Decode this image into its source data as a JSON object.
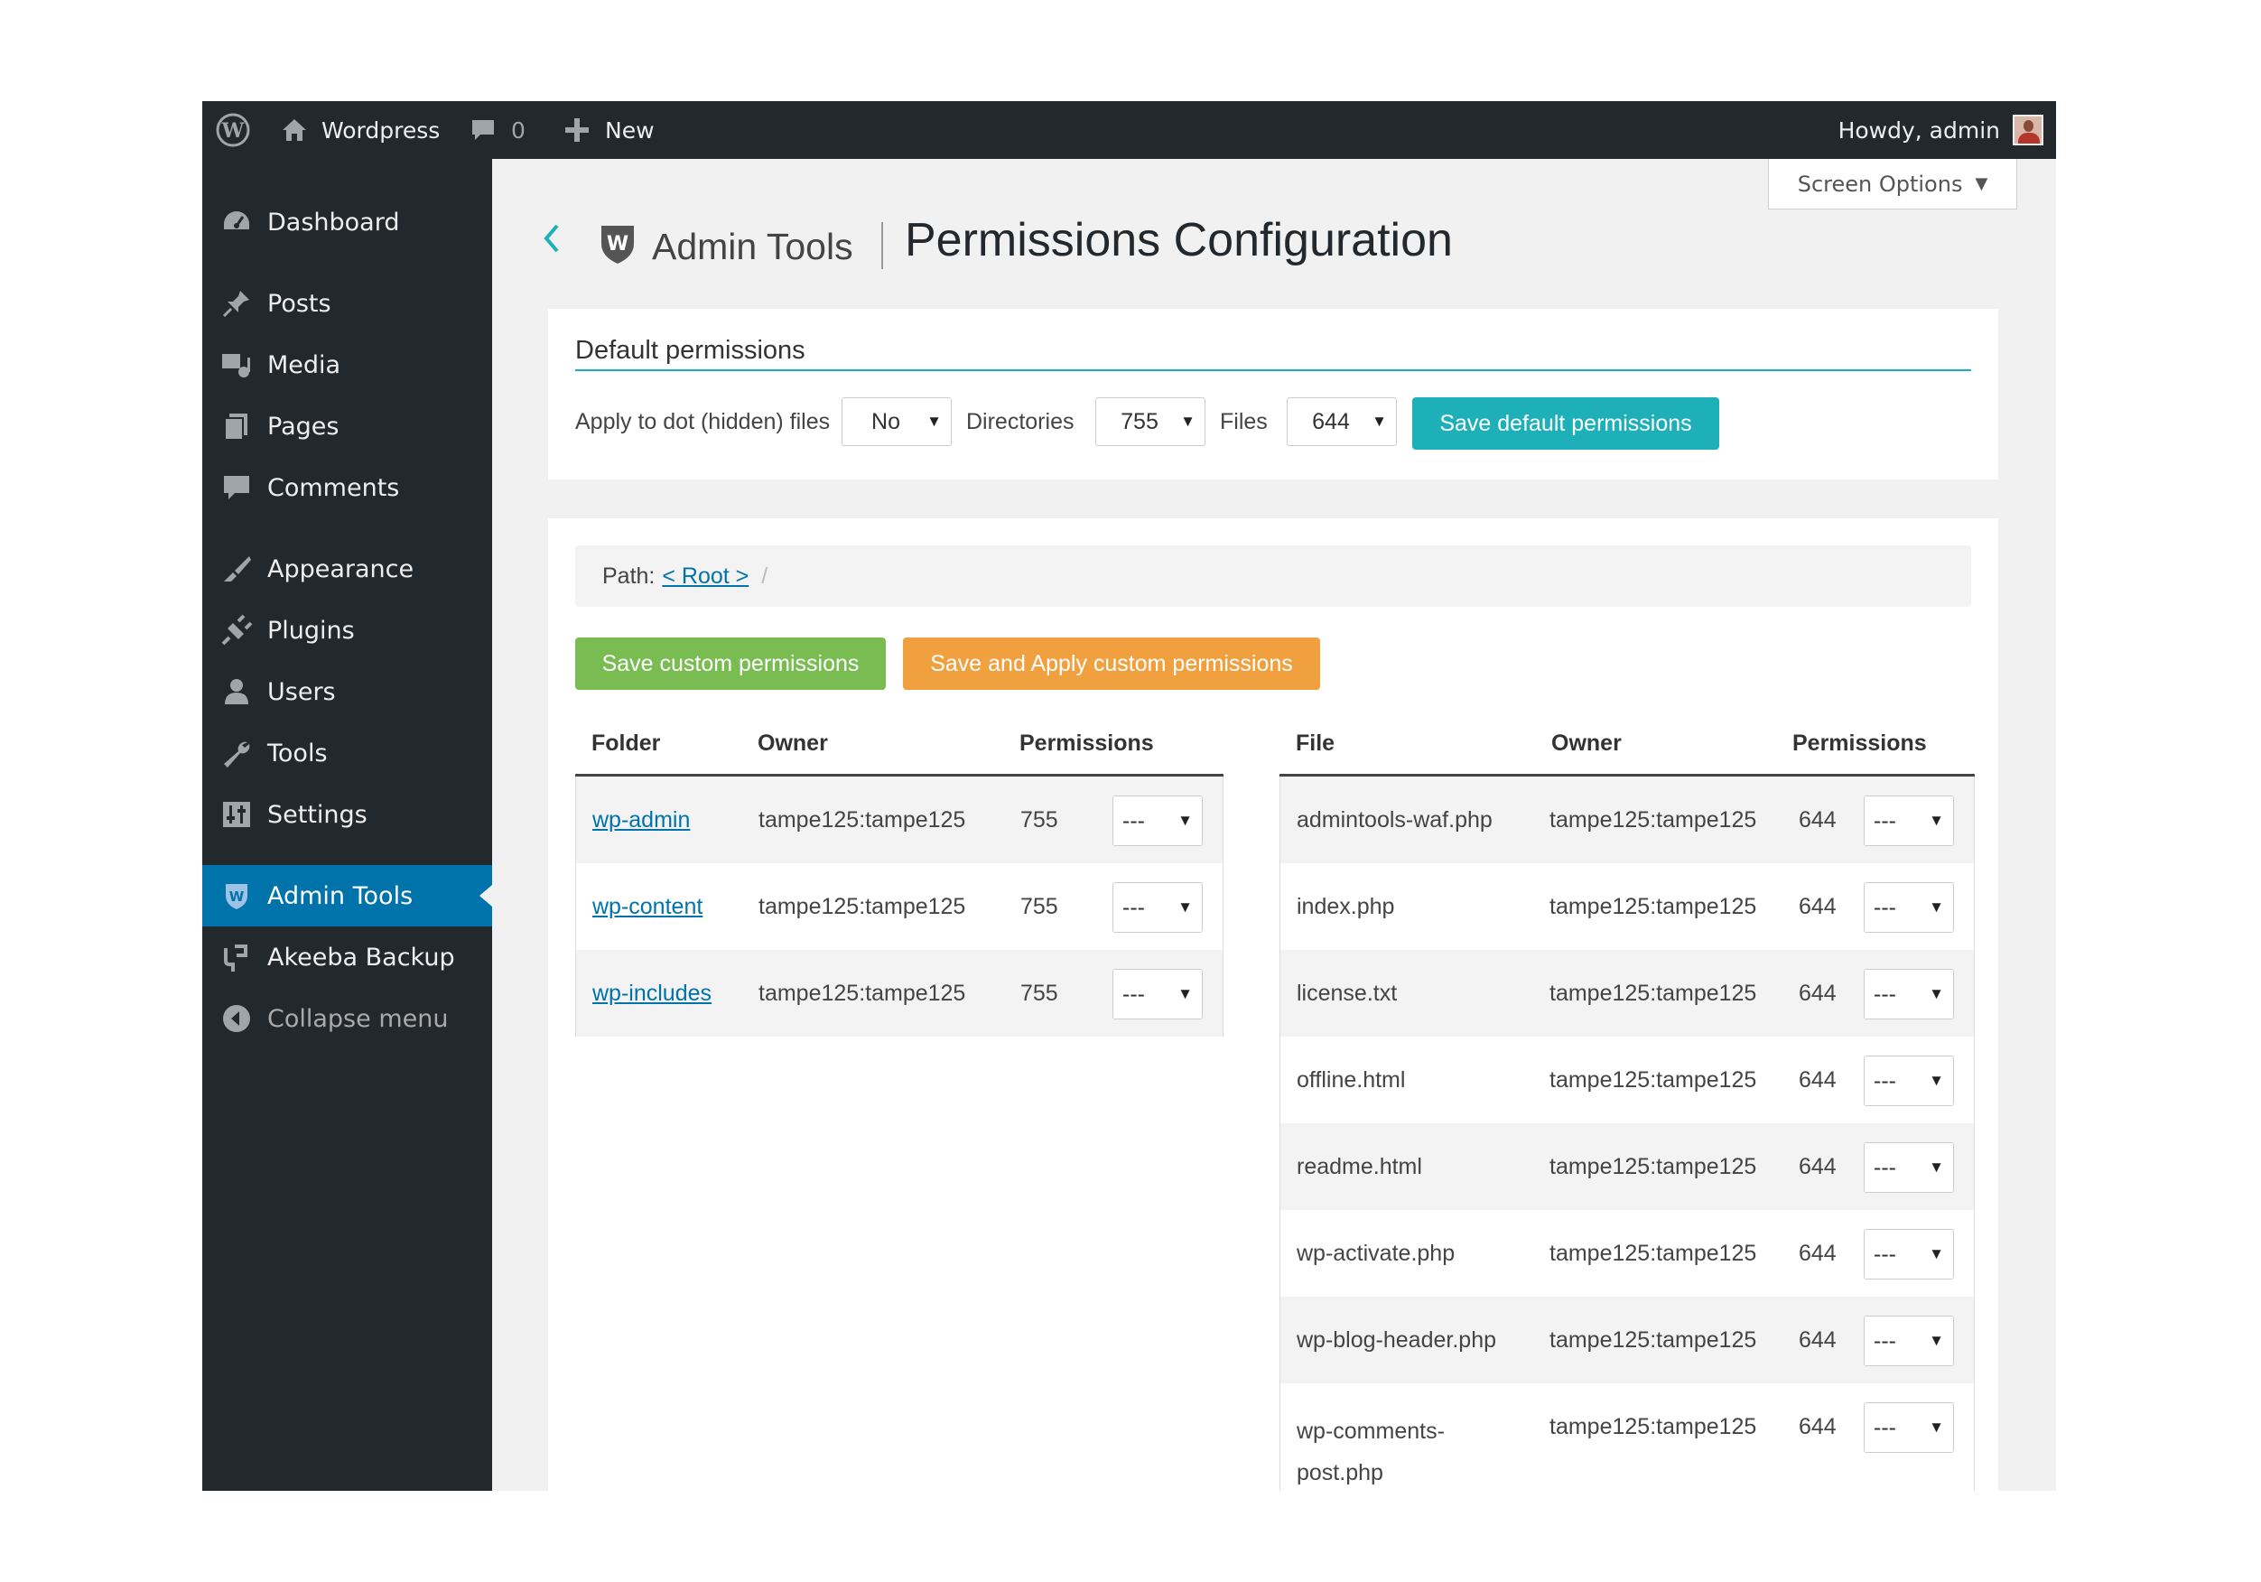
{
  "adminbar": {
    "site_name": "Wordpress",
    "comments_count": "0",
    "new_label": "New",
    "howdy": "Howdy, admin"
  },
  "sidebar": {
    "items": [
      {
        "label": "Dashboard",
        "icon": "dashboard-icon"
      },
      {
        "label": "Posts",
        "icon": "pin-icon"
      },
      {
        "label": "Media",
        "icon": "media-icon"
      },
      {
        "label": "Pages",
        "icon": "pages-icon"
      },
      {
        "label": "Comments",
        "icon": "comment-icon"
      },
      {
        "label": "Appearance",
        "icon": "brush-icon"
      },
      {
        "label": "Plugins",
        "icon": "plug-icon"
      },
      {
        "label": "Users",
        "icon": "user-icon"
      },
      {
        "label": "Tools",
        "icon": "wrench-icon"
      },
      {
        "label": "Settings",
        "icon": "settings-icon"
      },
      {
        "label": "Admin Tools",
        "icon": "shield-icon",
        "active": true
      },
      {
        "label": "Akeeba Backup",
        "icon": "akeeba-icon"
      },
      {
        "label": "Collapse menu",
        "icon": "collapse-icon"
      }
    ]
  },
  "header": {
    "screen_options": "Screen Options",
    "brand": "Admin Tools",
    "title": "Permissions Configuration"
  },
  "defaults": {
    "heading": "Default permissions",
    "dot_label": "Apply to dot (hidden) files",
    "dot_value": "No",
    "dirs_label": "Directories",
    "dirs_value": "755",
    "files_label": "Files",
    "files_value": "644",
    "save_label": "Save default permissions"
  },
  "path": {
    "label": "Path:",
    "root_link": "< Root > ",
    "slash": "/"
  },
  "actions": {
    "save_custom": "Save custom permissions",
    "save_apply": "Save and Apply custom permissions"
  },
  "folders": {
    "headers": {
      "name": "Folder",
      "owner": "Owner",
      "perms": "Permissions"
    },
    "rows": [
      {
        "name": "wp-admin",
        "owner": "tampe125:tampe125",
        "perms": "755",
        "select": "---"
      },
      {
        "name": "wp-content",
        "owner": "tampe125:tampe125",
        "perms": "755",
        "select": "---"
      },
      {
        "name": "wp-includes",
        "owner": "tampe125:tampe125",
        "perms": "755",
        "select": "---"
      }
    ]
  },
  "files": {
    "headers": {
      "name": "File",
      "owner": "Owner",
      "perms": "Permissions"
    },
    "rows": [
      {
        "name": "admintools-waf.php",
        "owner": "tampe125:tampe125",
        "perms": "644",
        "select": "---"
      },
      {
        "name": "index.php",
        "owner": "tampe125:tampe125",
        "perms": "644",
        "select": "---"
      },
      {
        "name": "license.txt",
        "owner": "tampe125:tampe125",
        "perms": "644",
        "select": "---"
      },
      {
        "name": "offline.html",
        "owner": "tampe125:tampe125",
        "perms": "644",
        "select": "---"
      },
      {
        "name": "readme.html",
        "owner": "tampe125:tampe125",
        "perms": "644",
        "select": "---"
      },
      {
        "name": "wp-activate.php",
        "owner": "tampe125:tampe125",
        "perms": "644",
        "select": "---"
      },
      {
        "name": "wp-blog-header.php",
        "owner": "tampe125:tampe125",
        "perms": "644",
        "select": "---"
      },
      {
        "name": "wp-comments-post.php",
        "owner": "tampe125:tampe125",
        "perms": "644",
        "select": "---"
      }
    ]
  },
  "colors": {
    "adminbar": "#23282d",
    "active_menu": "#0073aa",
    "teal": "#1eb0b8",
    "green": "#79bc52",
    "orange": "#f0a03e"
  }
}
